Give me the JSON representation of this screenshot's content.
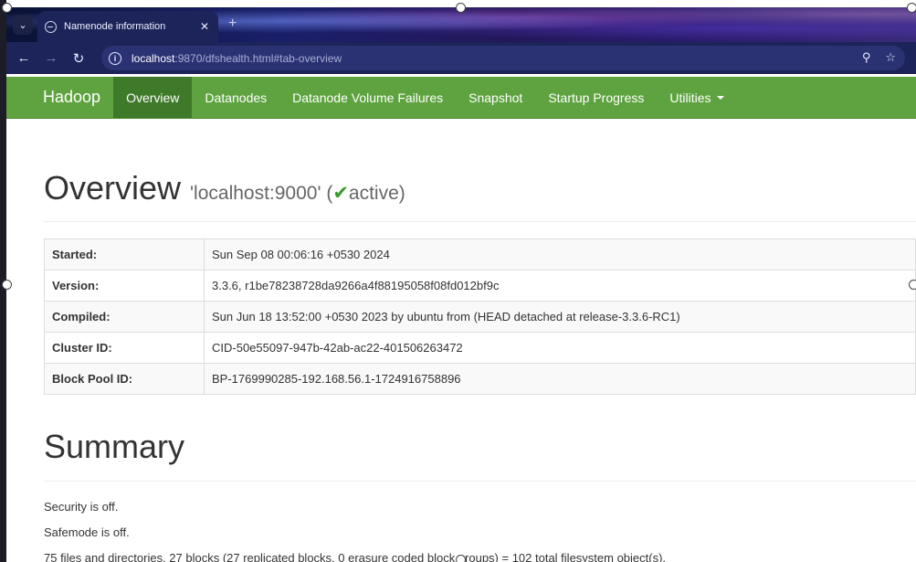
{
  "browser": {
    "tab_title": "Namenode information",
    "url_host": "localhost",
    "url_rest": ":9870/dfshealth.html#tab-overview"
  },
  "navbar": {
    "brand": "Hadoop",
    "items": [
      {
        "label": "Overview",
        "active": true
      },
      {
        "label": "Datanodes"
      },
      {
        "label": "Datanode Volume Failures"
      },
      {
        "label": "Snapshot"
      },
      {
        "label": "Startup Progress"
      },
      {
        "label": "Utilities"
      }
    ]
  },
  "overview": {
    "title": "Overview",
    "host": "'localhost:9000'",
    "status": "active",
    "rows": [
      {
        "key": "Started:",
        "value": "Sun Sep 08 00:06:16 +0530 2024"
      },
      {
        "key": "Version:",
        "value": "3.3.6, r1be78238728da9266a4f88195058f08fd012bf9c"
      },
      {
        "key": "Compiled:",
        "value": "Sun Jun 18 13:52:00 +0530 2023 by ubuntu from (HEAD detached at release-3.3.6-RC1)"
      },
      {
        "key": "Cluster ID:",
        "value": "CID-50e55097-947b-42ab-ac22-401506263472"
      },
      {
        "key": "Block Pool ID:",
        "value": "BP-1769990285-192.168.56.1-1724916758896"
      }
    ]
  },
  "summary": {
    "title": "Summary",
    "security": "Security is off.",
    "safemode": "Safemode is off.",
    "files": "75 files and directories, 27 blocks (27 replicated blocks, 0 erasure coded block groups) = 102 total filesystem object(s)."
  }
}
